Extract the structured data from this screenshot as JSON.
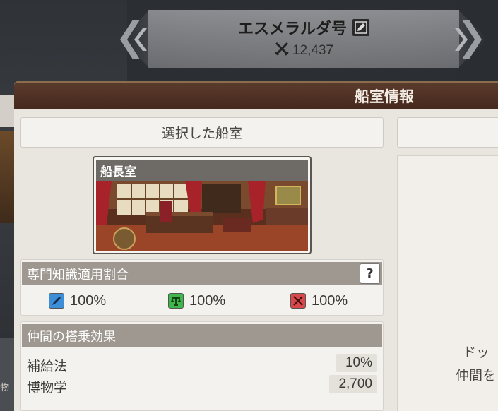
{
  "header": {
    "ship_name": "エスメラルダ号",
    "battle_power": "12,437"
  },
  "panel": {
    "title": "船室情報",
    "selected_cabin_label": "選択した船室"
  },
  "cabin": {
    "name": "船長室"
  },
  "expertise": {
    "title": "専門知識適用割合",
    "help": "?",
    "stats": [
      {
        "icon": "quill-icon",
        "value": "100%",
        "color": "#3c8fd6"
      },
      {
        "icon": "scales-icon",
        "value": "100%",
        "color": "#3fb74a"
      },
      {
        "icon": "crossed-swords-icon",
        "value": "100%",
        "color": "#d8474a"
      }
    ]
  },
  "companion": {
    "title": "仲間の搭乗効果",
    "effects": [
      {
        "name": "補給法",
        "value": "10%"
      },
      {
        "name": "博物学",
        "value": "2,700"
      }
    ]
  },
  "right_pane": {
    "line1": "ドッ",
    "line2": "仲間を"
  },
  "left_stub": {
    "text": "物"
  }
}
